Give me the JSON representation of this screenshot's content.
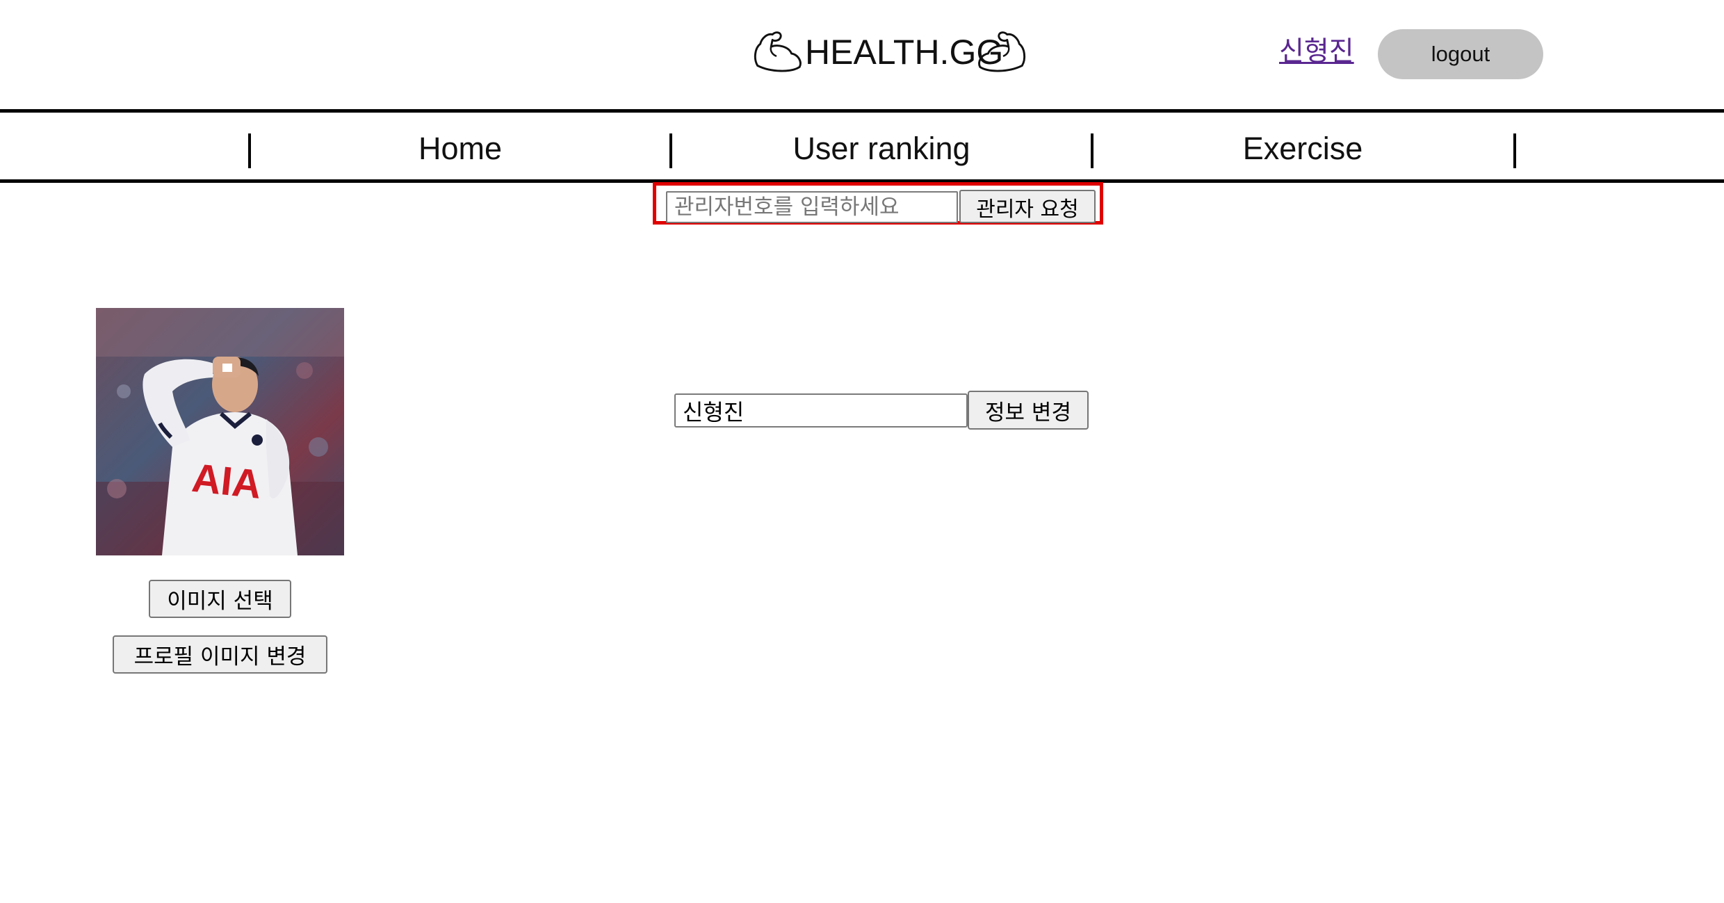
{
  "header": {
    "logo_text": "HEALTH.GG",
    "user_name": "신형진",
    "logout_label": "logout"
  },
  "nav": {
    "items": [
      {
        "label": "Home"
      },
      {
        "label": "User ranking"
      },
      {
        "label": "Exercise"
      }
    ],
    "separator": "|"
  },
  "admin_request": {
    "placeholder": "관리자번호를 입력하세요",
    "value": "",
    "button_label": "관리자 요청"
  },
  "profile": {
    "photo_jersey_text": "AIA",
    "select_image_label": "이미지 선택",
    "change_image_label": "프로필 이미지 변경"
  },
  "info": {
    "name_value": "신형진",
    "change_info_label": "정보 변경"
  },
  "colors": {
    "highlight_border": "#e00000",
    "logout_bg": "#c4c4c4",
    "link": "#5a2790"
  }
}
